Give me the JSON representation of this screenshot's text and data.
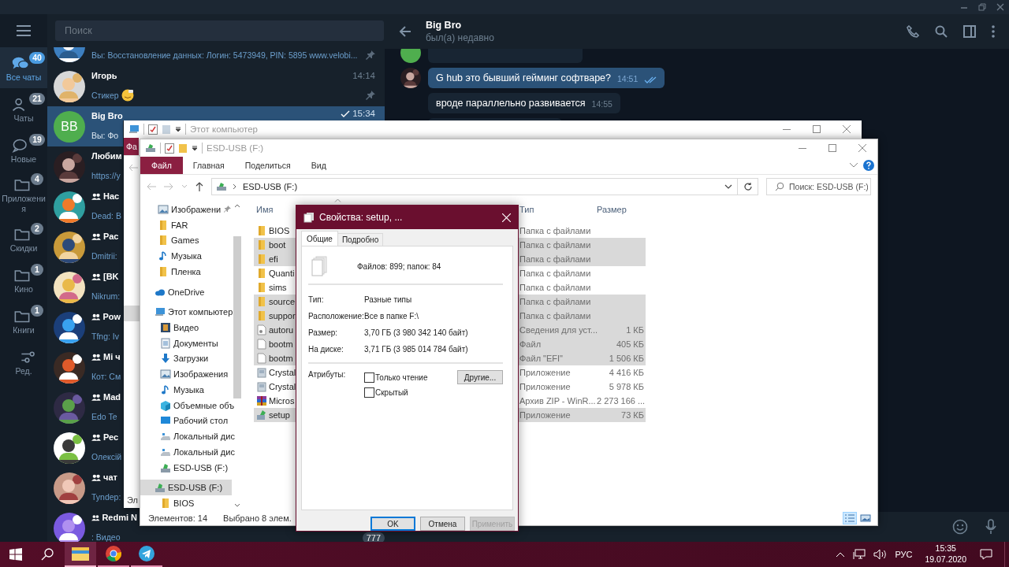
{
  "telegram": {
    "folders": [
      {
        "kind": "all",
        "label": "Все чаты",
        "badge": "40",
        "selected": true
      },
      {
        "kind": "private",
        "label": "Чаты",
        "badge": "21",
        "selected": false
      },
      {
        "kind": "new",
        "label": "Новые",
        "badge": "19",
        "selected": false
      },
      {
        "kind": "folder",
        "label": "Приложения",
        "badge": "4",
        "selected": false
      },
      {
        "kind": "folder",
        "label": "Скидки",
        "badge": "2",
        "selected": false
      },
      {
        "kind": "folder",
        "label": "Кино",
        "badge": "1",
        "selected": false
      },
      {
        "kind": "folder",
        "label": "Книги",
        "badge": "1",
        "selected": false
      },
      {
        "kind": "edit",
        "label": "Ред.",
        "selected": false
      }
    ],
    "search": {
      "placeholder": "Поиск"
    },
    "chats": [
      {
        "kind": "person",
        "preview": "Вы: Восстановление данных: Логин: 5473949, PIN: 5895 www.velobi...",
        "pinned": true,
        "emoji": false,
        "selected": false
      },
      {
        "kind": "person",
        "name": "Игорь",
        "time": "14:14",
        "preview": "Стикер",
        "pinned": true,
        "read": false,
        "emoji": true,
        "selected": false
      },
      {
        "kind": "person",
        "avatar": {
          "kind": "initials",
          "text": "BB"
        },
        "name": "Big Bro",
        "time": "15:34",
        "preview": "Вы: Фо",
        "pinned": false,
        "read": true,
        "emoji": false,
        "selected": true
      },
      {
        "kind": "person",
        "name": "Любим",
        "preview": "https://y",
        "selected": false
      },
      {
        "kind": "group",
        "name": "Нас",
        "preview": "Dead: B",
        "selected": false
      },
      {
        "kind": "group",
        "name": "Рас",
        "preview": "Dmitrii:",
        "selected": false
      },
      {
        "kind": "group",
        "name": "[BK",
        "preview": "Nikrum:",
        "selected": false
      },
      {
        "kind": "group",
        "name": "Pow",
        "preview": "Tfng: Iv",
        "selected": false
      },
      {
        "kind": "group",
        "name": "Mi ч",
        "preview": "Кот: См",
        "selected": false
      },
      {
        "kind": "group",
        "name": "Mad",
        "preview": "Edo Te",
        "selected": false
      },
      {
        "kind": "group",
        "name": "Рес",
        "preview": "Олексій",
        "selected": false
      },
      {
        "kind": "group",
        "name": "чат",
        "preview": "Tyndep:",
        "selected": false
      },
      {
        "kind": "group",
        "name": "Redmi N",
        "preview": ": Видео",
        "badge": "777",
        "selected": false
      }
    ]
  },
  "chat": {
    "title": "Big Bro",
    "status": "был(а) недавно",
    "messages": [
      {
        "text": "G hub это бывший гейминг софтваре?",
        "time": "14:51",
        "outgoing": true,
        "read": true
      },
      {
        "text": "вроде параллельно развивается",
        "time": "14:55",
        "outgoing": false,
        "read": false
      }
    ]
  },
  "explorer_back": {
    "title": "Этот компьютер",
    "ribbon_tab": "Фа",
    "status": "Эл"
  },
  "explorer": {
    "title": "ESD-USB (F:)",
    "ribbon_tabs": [
      {
        "label": "Файл",
        "selected": true
      },
      {
        "label": "Главная",
        "selected": false
      },
      {
        "label": "Поделиться",
        "selected": false
      },
      {
        "label": "Вид",
        "selected": false
      }
    ],
    "address": "ESD-USB (F:)",
    "search": {
      "placeholder": "Поиск: ESD-USB (F:)"
    },
    "nav": [
      {
        "kind": "pictures",
        "label": "Изображени",
        "pinned": true,
        "selected": false
      },
      {
        "kind": "folder",
        "label": "FAR",
        "pinned": false,
        "selected": false
      },
      {
        "kind": "folder",
        "label": "Games",
        "pinned": false,
        "selected": false
      },
      {
        "kind": "music",
        "label": "Музыка",
        "pinned": false,
        "selected": false
      },
      {
        "kind": "folder",
        "label": "Пленка",
        "pinned": false,
        "selected": false
      },
      {
        "kind": "cloud",
        "label": "OneDrive",
        "selected": false
      },
      {
        "kind": "pc",
        "label": "Этот компьютер",
        "selected": false,
        "children": [
          {
            "kind": "video",
            "label": "Видео",
            "selected": false
          },
          {
            "kind": "docs",
            "label": "Документы",
            "selected": false
          },
          {
            "kind": "download",
            "label": "Загрузки",
            "selected": false
          },
          {
            "kind": "pictures",
            "label": "Изображения",
            "selected": false
          },
          {
            "kind": "music",
            "label": "Музыка",
            "selected": false
          },
          {
            "kind": "cube",
            "label": "Объемные объ",
            "selected": false
          },
          {
            "kind": "desktop",
            "label": "Рабочий стол",
            "selected": false
          },
          {
            "kind": "disk",
            "label": "Локальный дис",
            "selected": false
          },
          {
            "kind": "disk",
            "label": "Локальный дис",
            "selected": false
          },
          {
            "kind": "usb",
            "label": "ESD-USB (F:)",
            "selected": false
          }
        ]
      },
      {
        "kind": "usb",
        "label": "ESD-USB (F:)",
        "selected": true,
        "children": [
          {
            "kind": "folder",
            "label": "BIOS",
            "selected": false
          }
        ]
      }
    ],
    "columns": {
      "name": "Имя",
      "type": "Тип",
      "size": "Размер"
    },
    "files": [
      {
        "kind": "folder",
        "name": "BIOS",
        "type": "Папка с файлами",
        "selected": false
      },
      {
        "kind": "folder",
        "name": "boot",
        "type": "Папка с файлами",
        "selected": true
      },
      {
        "kind": "folder",
        "name": "efi",
        "type": "Папка с файлами",
        "selected": true
      },
      {
        "kind": "folder",
        "name": "Quanti",
        "type": "Папка с файлами",
        "selected": false
      },
      {
        "kind": "folder",
        "name": "sims",
        "type": "Папка с файлами",
        "selected": false
      },
      {
        "kind": "folder",
        "name": "source",
        "type": "Папка с файлами",
        "selected": true
      },
      {
        "kind": "folder",
        "name": "suppor",
        "type": "Папка с файлами",
        "selected": true
      },
      {
        "kind": "info",
        "name": "autoru",
        "type": "Сведения для уст...",
        "size": "1 КБ",
        "selected": true
      },
      {
        "kind": "file",
        "name": "bootm",
        "type": "Файл",
        "size": "405 КБ",
        "selected": true
      },
      {
        "kind": "file",
        "name": "bootm",
        "type": "Файл \"EFI\"",
        "size": "1 506 КБ",
        "selected": true
      },
      {
        "kind": "app",
        "name": "Crystal",
        "type": "Приложение",
        "size": "4 416 КБ",
        "selected": false
      },
      {
        "kind": "app",
        "name": "Crystal",
        "type": "Приложение",
        "size": "5 978 КБ",
        "selected": false
      },
      {
        "kind": "archive",
        "name": "Micros",
        "type": "Архив ZIP - WinR...",
        "size": "2 273 166 ...",
        "selected": false
      },
      {
        "kind": "setup",
        "name": "setup",
        "type": "Приложение",
        "size": "73 КБ",
        "selected": true
      }
    ],
    "status": {
      "count": "Элементов: 14",
      "selection": "Выбрано 8 элем."
    },
    "views": [
      {
        "kind": "details",
        "selected": true
      },
      {
        "kind": "tiles",
        "selected": false
      }
    ]
  },
  "properties": {
    "title": "Свойства: setup, ...",
    "tabs": [
      {
        "label": "Общие",
        "selected": true
      },
      {
        "label": "Подробно",
        "selected": false
      }
    ],
    "summary": "Файлов: 899; папок: 84",
    "rows": [
      {
        "label": "Тип:",
        "value": "Разные типы"
      },
      {
        "label": "Расположение:",
        "value": "Все в папке F:\\"
      },
      {
        "label": "Размер:",
        "value": "3,70 ГБ (3 980 342 140 байт)"
      },
      {
        "label": "На диске:",
        "value": "3,71 ГБ (3 985 014 784 байт)"
      }
    ],
    "attributes_label": "Атрибуты:",
    "checkboxes": [
      {
        "label": "Только чтение",
        "checked": false
      },
      {
        "label": "Скрытый",
        "checked": false
      }
    ],
    "advanced_button": "Другие...",
    "buttons": [
      {
        "label": "OK",
        "default": true,
        "disabled": false
      },
      {
        "label": "Отмена",
        "default": false,
        "disabled": false
      },
      {
        "label": "Применить",
        "default": false,
        "disabled": true
      }
    ]
  },
  "taskbar": {
    "apps": [
      {
        "kind": "explorer",
        "active": true
      },
      {
        "kind": "browser",
        "active": false
      },
      {
        "kind": "messenger",
        "active": false
      }
    ],
    "language": "РУС",
    "time": "15:35",
    "date": "19.07.2020"
  }
}
